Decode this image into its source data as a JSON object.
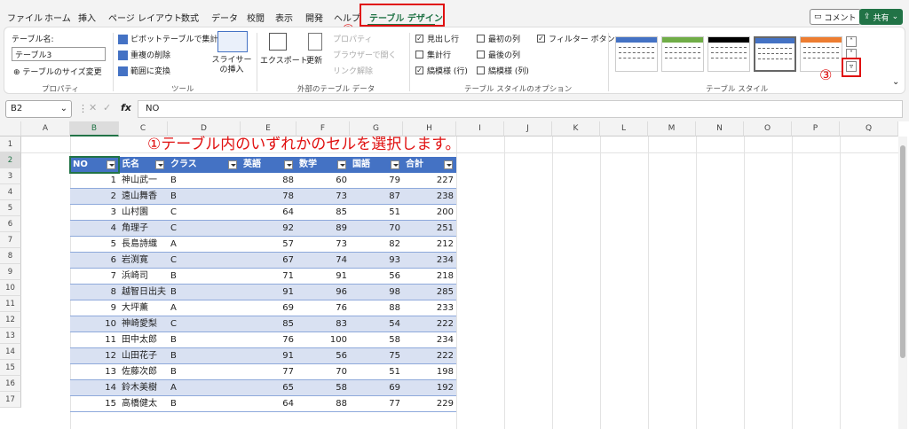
{
  "tabs": [
    "ファイル",
    "ホーム",
    "挿入",
    "ページ レイアウト",
    "数式",
    "データ",
    "校閲",
    "表示",
    "開発",
    "ヘルプ",
    "テーブル デザイン"
  ],
  "buttons": {
    "comment": "コメント",
    "share": "共有"
  },
  "markers": {
    "one": "①テーブル内のいずれかのセルを選択します。",
    "two": "②",
    "three": "③"
  },
  "ribbon": {
    "properties": {
      "table_name_label": "テーブル名:",
      "table_name_value": "テーブル3",
      "resize": "テーブルのサイズ変更",
      "group": "プロパティ"
    },
    "tools": {
      "pivot": "ピボットテーブルで集計",
      "remove_dup": "重複の削除",
      "convert": "範囲に変換",
      "slicer": "スライサーの挿入",
      "group": "ツール"
    },
    "external": {
      "export": "エクスポート",
      "refresh": "更新",
      "properties": "プロパティ",
      "open_browser": "ブラウザーで開く",
      "unlink": "リンク解除",
      "group": "外部のテーブル データ"
    },
    "options": {
      "header_row": "見出し行",
      "total_row": "集計行",
      "banded_rows": "縞模様 (行)",
      "first_col": "最初の列",
      "last_col": "最後の列",
      "banded_cols": "縞模様 (列)",
      "filter_btn": "フィルター ボタン",
      "group": "テーブル スタイルのオプション"
    },
    "styles": {
      "group": "テーブル スタイル"
    }
  },
  "formula_bar": {
    "name_box": "B2",
    "fx": "fx",
    "value": "NO"
  },
  "columns": [
    "A",
    "B",
    "C",
    "D",
    "E",
    "F",
    "G",
    "H",
    "I",
    "J",
    "K",
    "L",
    "M",
    "N",
    "O",
    "P",
    "Q"
  ],
  "rows": [
    "1",
    "2",
    "3",
    "4",
    "5",
    "6",
    "7",
    "8",
    "9",
    "10",
    "11",
    "12",
    "13",
    "14",
    "15",
    "16",
    "17"
  ],
  "table": {
    "headers": [
      "NO",
      "氏名",
      "クラス",
      "英語",
      "数学",
      "国語",
      "合計"
    ],
    "data": [
      [
        "1",
        "神山武一",
        "B",
        "88",
        "60",
        "79",
        "227"
      ],
      [
        "2",
        "遠山舞香",
        "B",
        "78",
        "73",
        "87",
        "238"
      ],
      [
        "3",
        "山村園",
        "C",
        "64",
        "85",
        "51",
        "200"
      ],
      [
        "4",
        "角理子",
        "C",
        "92",
        "89",
        "70",
        "251"
      ],
      [
        "5",
        "長島詩織",
        "A",
        "57",
        "73",
        "82",
        "212"
      ],
      [
        "6",
        "岩渕寛",
        "C",
        "67",
        "74",
        "93",
        "234"
      ],
      [
        "7",
        "浜崎司",
        "B",
        "71",
        "91",
        "56",
        "218"
      ],
      [
        "8",
        "越智日出夫",
        "B",
        "91",
        "96",
        "98",
        "285"
      ],
      [
        "9",
        "大坪薫",
        "A",
        "69",
        "76",
        "88",
        "233"
      ],
      [
        "10",
        "神崎愛梨",
        "C",
        "85",
        "83",
        "54",
        "222"
      ],
      [
        "11",
        "田中太郎",
        "B",
        "76",
        "100",
        "58",
        "234"
      ],
      [
        "12",
        "山田花子",
        "B",
        "91",
        "56",
        "75",
        "222"
      ],
      [
        "13",
        "佐藤次郎",
        "B",
        "77",
        "70",
        "51",
        "198"
      ],
      [
        "14",
        "鈴木美樹",
        "A",
        "65",
        "58",
        "69",
        "192"
      ],
      [
        "15",
        "高橋健太",
        "B",
        "64",
        "88",
        "77",
        "229"
      ]
    ]
  },
  "colors": {
    "accent": "#217346",
    "table_header": "#4472c4",
    "band": "#d9e1f2",
    "annotation": "#e01010"
  }
}
